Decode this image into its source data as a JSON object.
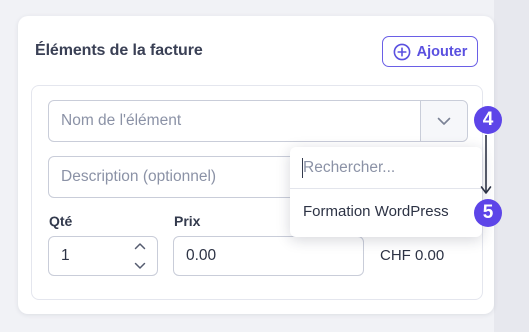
{
  "section": {
    "title": "Éléments de la facture",
    "add_button_label": "Ajouter"
  },
  "item": {
    "name_placeholder": "Nom de l'élément",
    "description_placeholder": "Description (optionnel)",
    "qty_label": "Qté",
    "qty_value": "1",
    "price_label": "Prix",
    "price_value": "0.00",
    "total": "CHF 0.00"
  },
  "dropdown": {
    "search_placeholder": "Rechercher...",
    "options": [
      "Formation WordPress"
    ]
  },
  "annotations": {
    "step_4": "4",
    "step_5": "5"
  },
  "colors": {
    "accent": "#5a50e0",
    "badge": "#5d45e8"
  },
  "icons": {
    "add": "plus-circle-icon",
    "select": "chevron-down-icon",
    "spin": "chevron-up-down-icon",
    "annotation_arrow": "arrow-down-icon"
  }
}
